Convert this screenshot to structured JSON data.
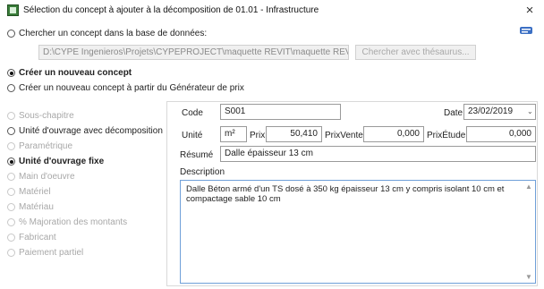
{
  "window": {
    "title": "Sélection du concept à ajouter à la décomposition de 01.01 - Infrastructure",
    "close": "×"
  },
  "options": {
    "search_db": "Chercher un concept dans la base de données:",
    "db_path": "D:\\CYPE Ingenieros\\Projets\\CYPEPROJECT\\maquette REVIT\\maquette REVIT",
    "search_thesaurus": "Chercher avec thésaurus...",
    "create_new": "Créer un nouveau concept",
    "create_from_generator": "Créer un nouveau concept à partir du Générateur de prix"
  },
  "types": [
    {
      "label": "Sous-chapitre",
      "enabled": false,
      "selected": false,
      "bold": false
    },
    {
      "label": "Unité d'ouvrage avec décomposition",
      "enabled": true,
      "selected": false,
      "bold": false
    },
    {
      "label": "Paramétrique",
      "enabled": false,
      "selected": false,
      "bold": false
    },
    {
      "label": "Unité d'ouvrage fixe",
      "enabled": true,
      "selected": true,
      "bold": true
    },
    {
      "label": "Main d'oeuvre",
      "enabled": false,
      "selected": false,
      "bold": false
    },
    {
      "label": "Matériel",
      "enabled": false,
      "selected": false,
      "bold": false
    },
    {
      "label": "Matériau",
      "enabled": false,
      "selected": false,
      "bold": false
    },
    {
      "label": "% Majoration des montants",
      "enabled": false,
      "selected": false,
      "bold": false
    },
    {
      "label": "Fabricant",
      "enabled": false,
      "selected": false,
      "bold": false
    },
    {
      "label": "Paiement partiel",
      "enabled": false,
      "selected": false,
      "bold": false
    }
  ],
  "form": {
    "code_label": "Code",
    "code_value": "S001",
    "date_label": "Date",
    "date_value": "23/02/2019",
    "unit_label": "Unité",
    "unit_value": "m²",
    "price_label": "Prix",
    "price_value": "50,410",
    "price_sale_label": "PrixVente",
    "price_sale_value": "0,000",
    "price_study_label": "PrixÉtude",
    "price_study_value": "0,000",
    "summary_label": "Résumé",
    "summary_value": "Dalle épaisseur 13 cm",
    "description_label": "Description",
    "description_value": "Dalle Béton armé d'un TS dosé à 350 kg épaisseur 13 cm y compris isolant 10 cm et compactage sable 10 cm"
  }
}
